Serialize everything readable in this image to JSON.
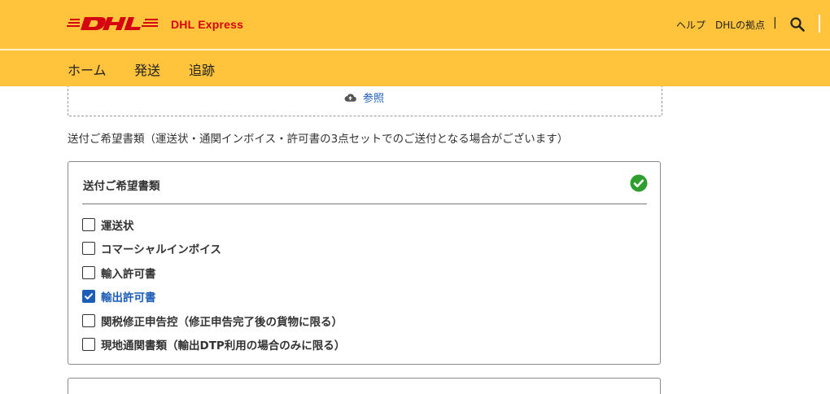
{
  "header": {
    "brand": "DHL Express",
    "help": "ヘルプ",
    "locations": "DHLの拠点",
    "separator": "|"
  },
  "nav": {
    "home": "ホーム",
    "ship": "発送",
    "track": "追跡"
  },
  "upload": {
    "browse_label": "参照"
  },
  "hint_text": "送付ご希望書類（運送状・通関インボイス・許可書の3点セットでのご送付となる場合がございます）",
  "documents": {
    "title": "送付ご希望書類",
    "options": [
      {
        "label": "運送状",
        "checked": false
      },
      {
        "label": "コマーシャルインボイス",
        "checked": false
      },
      {
        "label": "輸入許可書",
        "checked": false
      },
      {
        "label": "輸出許可書",
        "checked": true
      },
      {
        "label": "関税修正申告控（修正申告完了後の貨物に限る）",
        "checked": false
      },
      {
        "label": "現地通関書類（輸出DTP利用の場合のみに限る）",
        "checked": false
      }
    ]
  },
  "colors": {
    "brand_yellow": "#FFC33C",
    "brand_red": "#D40511",
    "link_blue": "#1c5db8",
    "success_green": "#2e9e2e"
  }
}
